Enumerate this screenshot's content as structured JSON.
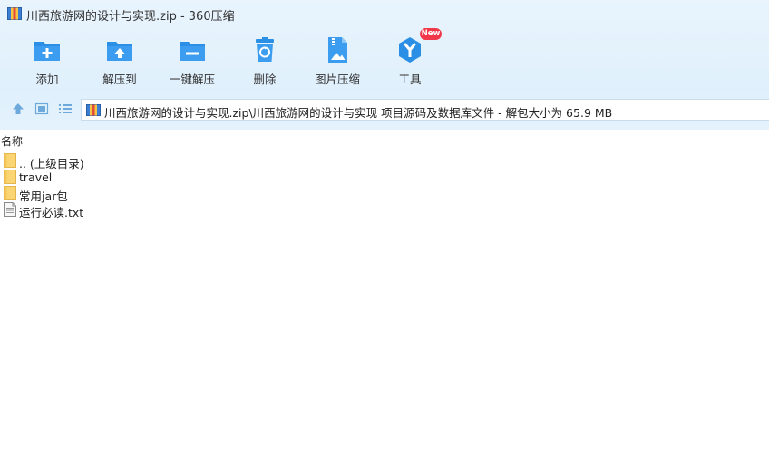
{
  "window": {
    "title": "川西旅游网的设计与实现.zip - 360压缩"
  },
  "toolbar": {
    "items": [
      {
        "label": "添加",
        "icon": "add-folder-icon"
      },
      {
        "label": "解压到",
        "icon": "extract-to-icon"
      },
      {
        "label": "一键解压",
        "icon": "one-click-extract-icon"
      },
      {
        "label": "删除",
        "icon": "delete-bin-icon"
      },
      {
        "label": "图片压缩",
        "icon": "image-compress-icon"
      },
      {
        "label": "工具",
        "icon": "tools-icon",
        "badge": "New"
      }
    ]
  },
  "navbar": {
    "path": "川西旅游网的设计与实现.zip\\川西旅游网的设计与实现 项目源码及数据库文件 - 解包大小为 65.9 MB"
  },
  "file_list": {
    "column_name": "名称",
    "rows": [
      {
        "name": ".. (上级目录)",
        "type": "folder"
      },
      {
        "name": "travel",
        "type": "folder"
      },
      {
        "name": "常用jar包",
        "type": "folder"
      },
      {
        "name": "运行必读.txt",
        "type": "text-file"
      }
    ]
  },
  "colors": {
    "accent": "#2a8fe5",
    "folder": "#fbd474",
    "badge": "#f0384a"
  }
}
